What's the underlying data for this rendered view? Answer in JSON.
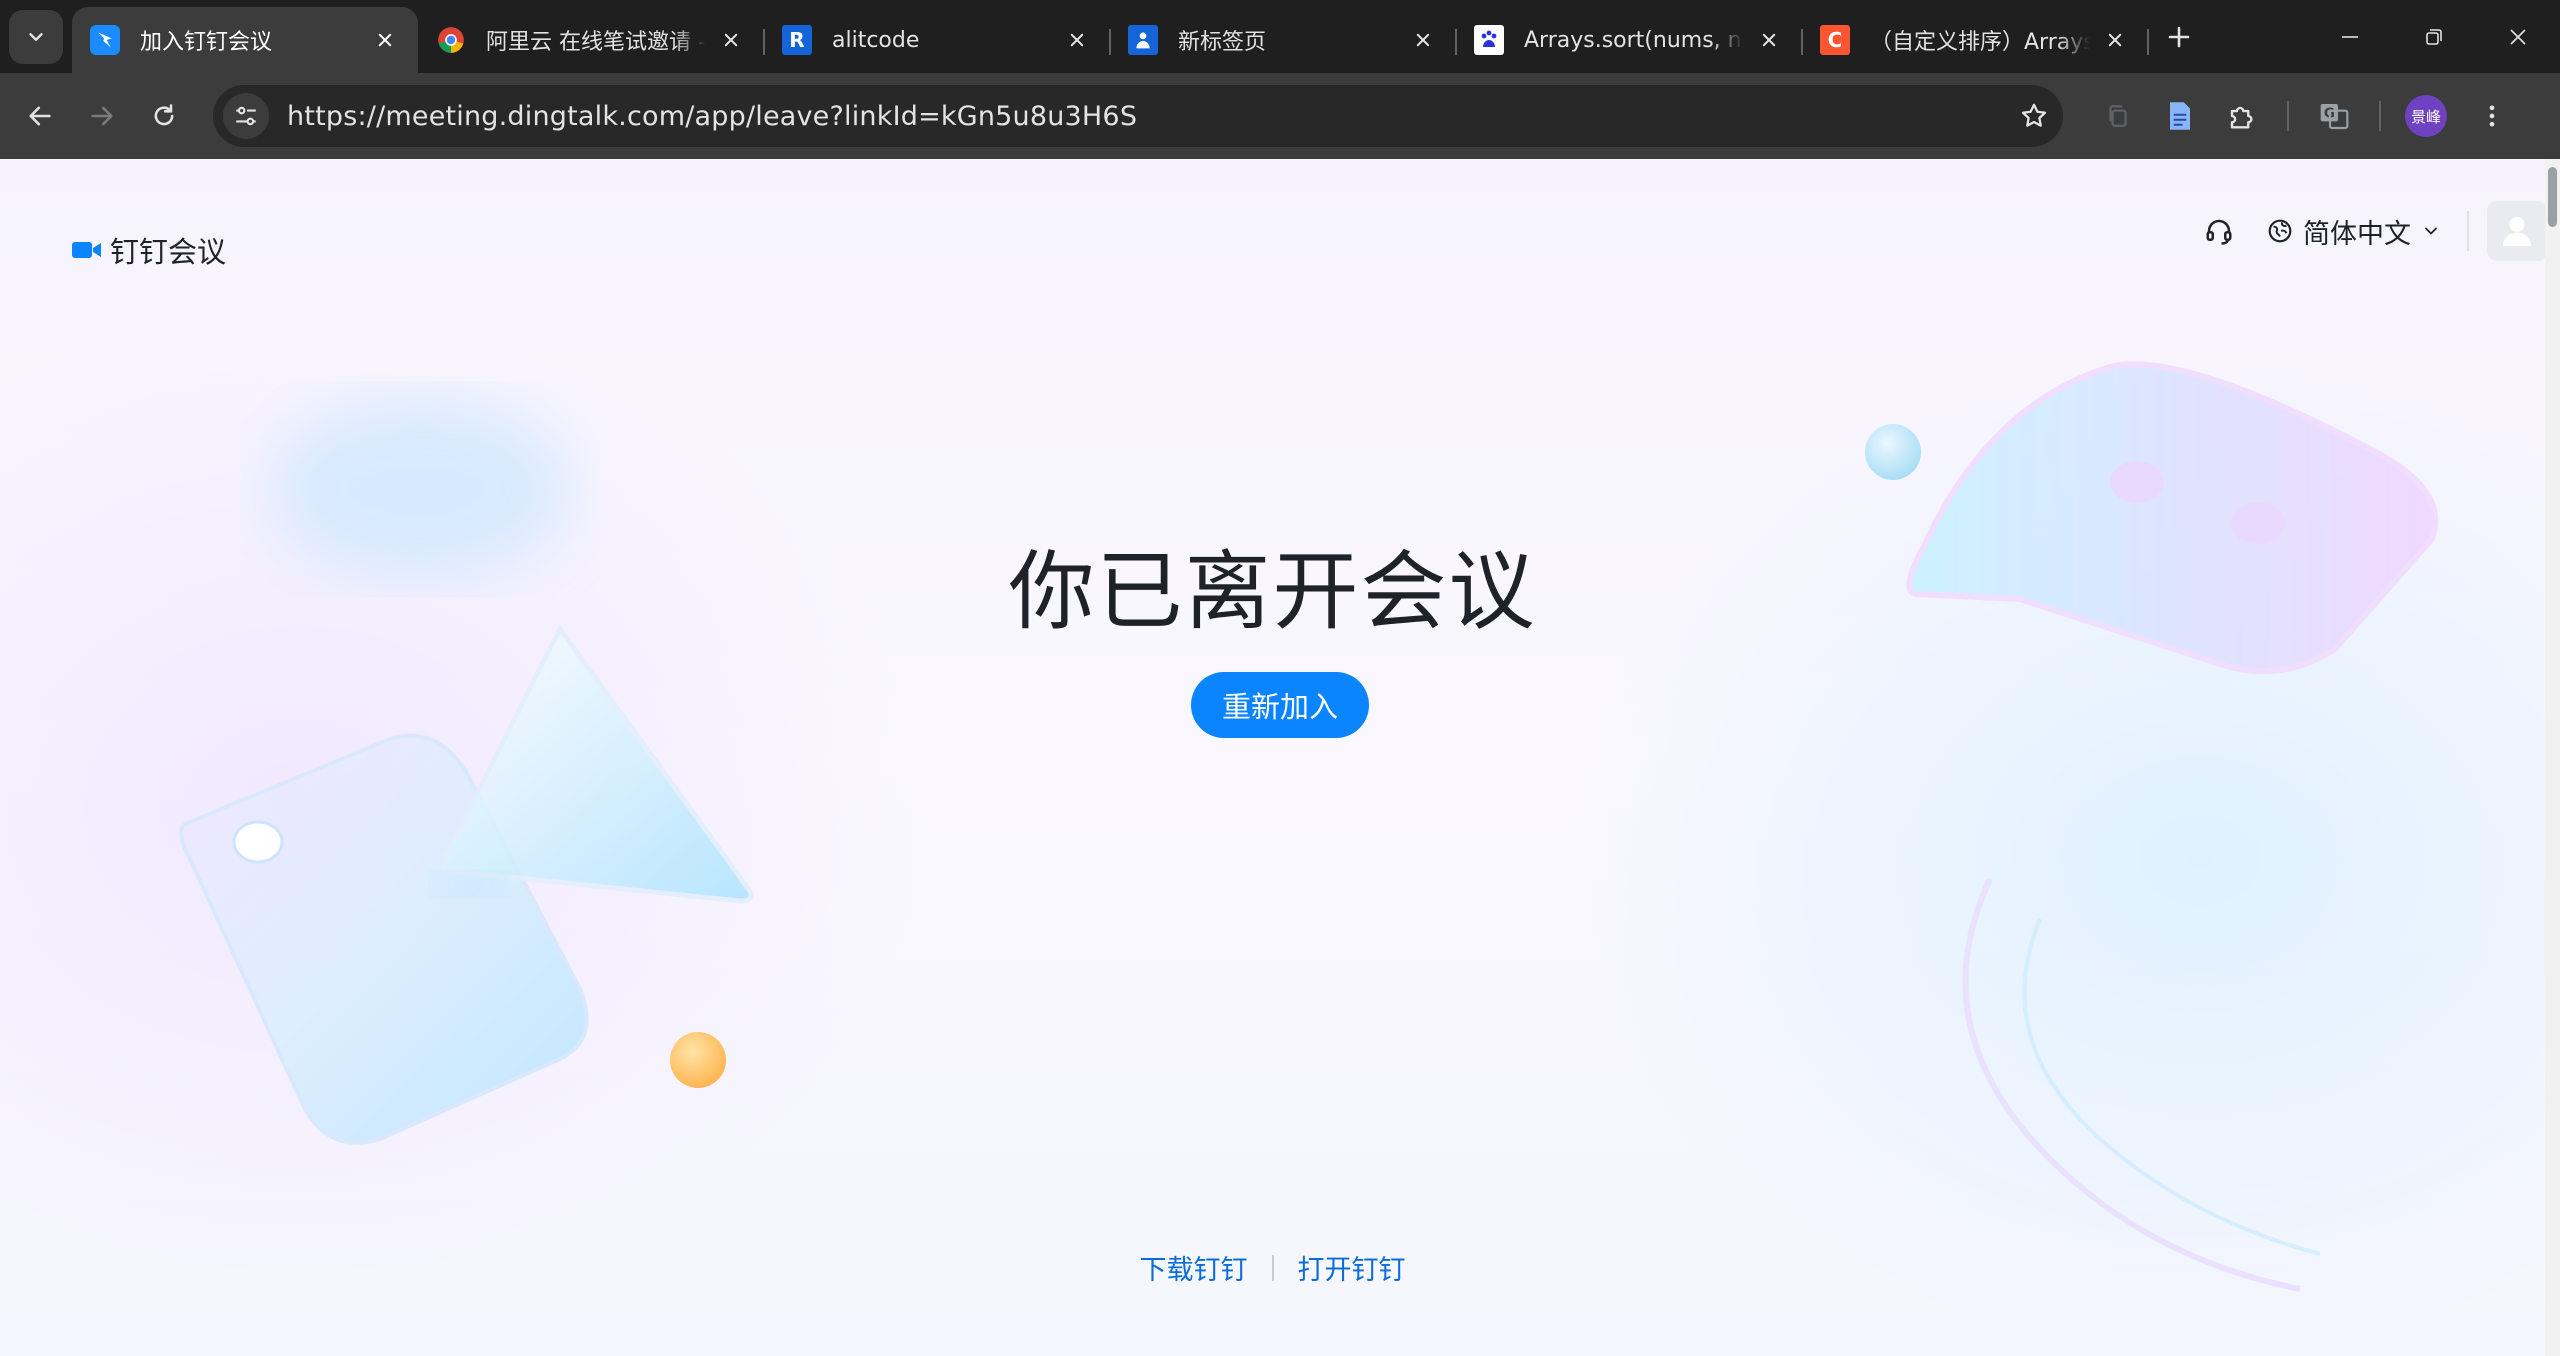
{
  "browser": {
    "tabs": [
      {
        "title": "加入钉钉会议",
        "active": true,
        "icon": "dingtalk-icon",
        "color": "#1a8cff"
      },
      {
        "title": "阿里云 在线笔试邀请 - C",
        "active": false,
        "icon": "chrome-icon",
        "color": "#ffffff"
      },
      {
        "title": "alitcode",
        "active": false,
        "icon": "r-icon",
        "color": "#1565d8"
      },
      {
        "title": "新标签页",
        "active": false,
        "icon": "newtab-icon",
        "color": "#1565d8"
      },
      {
        "title": "Arrays.sort(nums, new",
        "active": false,
        "icon": "baidu-icon",
        "color": "#2932e1"
      },
      {
        "title": "（自定义排序）Arrays.s",
        "active": false,
        "icon": "csdn-icon",
        "color": "#fc5531"
      }
    ],
    "url": "https://meeting.dingtalk.com/app/leave?linkId=kGn5u8u3H6S",
    "profile_initials": "景峰"
  },
  "page": {
    "brand_label": "钉钉会议",
    "language": "简体中文",
    "headline": "你已离开会议",
    "rejoin_button": "重新加入",
    "footer": {
      "download": "下载钉钉",
      "open": "打开钉钉"
    }
  },
  "colors": {
    "accent": "#0a84ff",
    "link": "#0a6dd9"
  }
}
